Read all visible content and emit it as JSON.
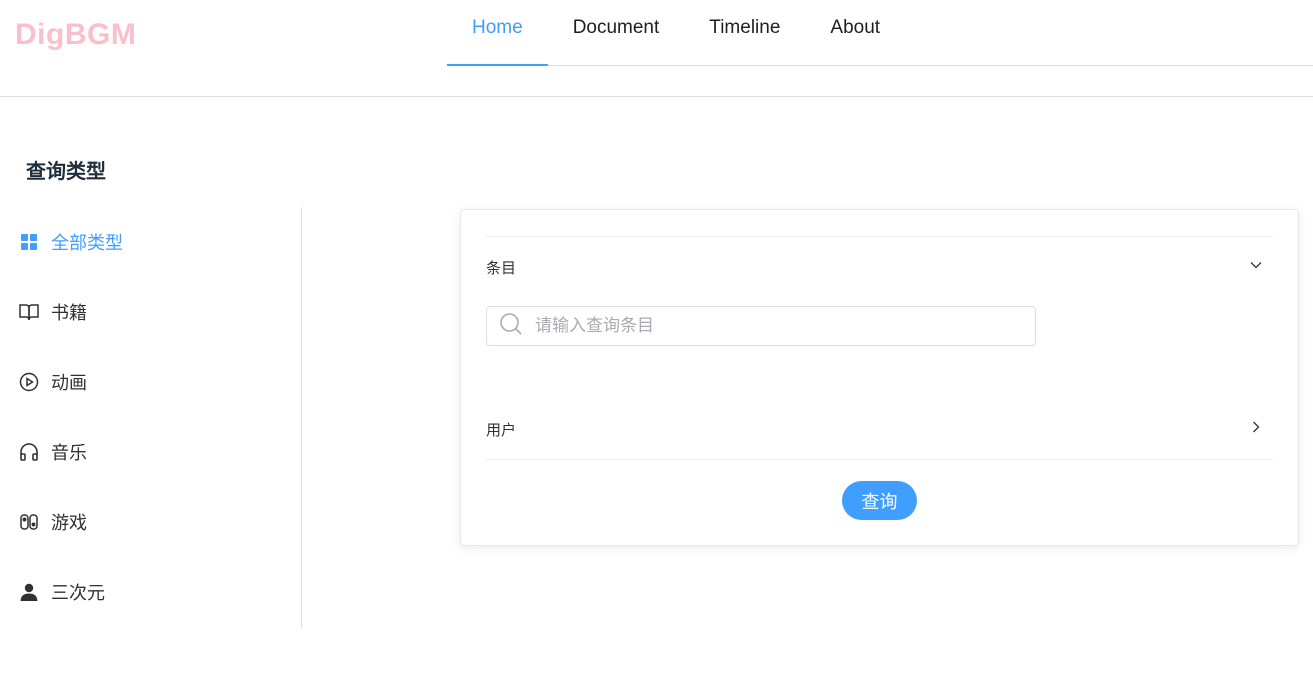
{
  "brand": {
    "logo_text": "DigBGM",
    "logo_color": "#f9c0cb"
  },
  "nav": {
    "items": [
      {
        "label": "Home",
        "active": true
      },
      {
        "label": "Document",
        "active": false
      },
      {
        "label": "Timeline",
        "active": false
      },
      {
        "label": "About",
        "active": false
      }
    ]
  },
  "sidebar": {
    "title": "查询类型",
    "items": [
      {
        "label": "全部类型",
        "icon": "grid-icon",
        "active": true
      },
      {
        "label": "书籍",
        "icon": "book-icon",
        "active": false
      },
      {
        "label": "动画",
        "icon": "play-circle-icon",
        "active": false
      },
      {
        "label": "音乐",
        "icon": "headphones-icon",
        "active": false
      },
      {
        "label": "游戏",
        "icon": "game-controller-icon",
        "active": false
      },
      {
        "label": "三次元",
        "icon": "person-icon",
        "active": false
      }
    ]
  },
  "panel": {
    "subject_section": {
      "label": "条目",
      "expanded": true,
      "chevron_icon": "chevron-down-icon"
    },
    "search": {
      "placeholder": "请输入查询条目",
      "value": "",
      "icon": "search-icon"
    },
    "user_section": {
      "label": "用户",
      "expanded": false,
      "chevron_icon": "chevron-right-icon"
    },
    "submit_label": "查询"
  },
  "colors": {
    "accent": "#409eff",
    "text": "#303133",
    "border": "#dcdfe6"
  }
}
